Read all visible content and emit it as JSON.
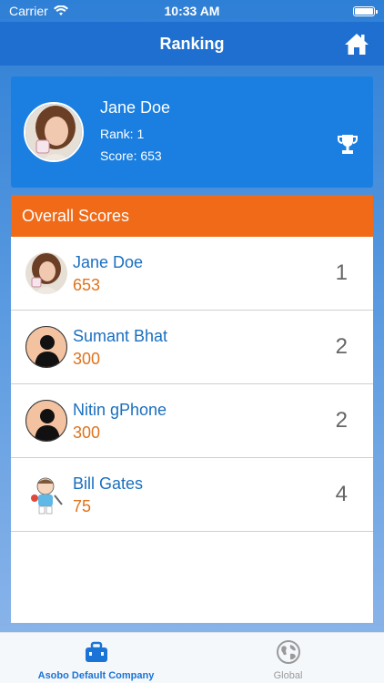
{
  "status_bar": {
    "carrier": "Carrier",
    "time": "10:33 AM"
  },
  "nav": {
    "title": "Ranking",
    "home_icon": "home-icon"
  },
  "profile": {
    "name": "Jane Doe",
    "rank_text": "Rank: 1",
    "score_text": "Score: 653",
    "trophy_icon": "trophy-icon"
  },
  "scores": {
    "header": "Overall Scores",
    "rows": [
      {
        "name": "Jane Doe",
        "score": "653",
        "rank": "1",
        "avatar": "photo"
      },
      {
        "name": "Sumant Bhat",
        "score": "300",
        "rank": "2",
        "avatar": "silhouette"
      },
      {
        "name": "Nitin gPhone",
        "score": "300",
        "rank": "2",
        "avatar": "silhouette"
      },
      {
        "name": "Bill Gates",
        "score": "75",
        "rank": "4",
        "avatar": "cartoon"
      }
    ]
  },
  "tabs": [
    {
      "label": "Asobo Default Company",
      "icon": "briefcase-icon",
      "active": true
    },
    {
      "label": "Global",
      "icon": "globe-icon",
      "active": false
    }
  ],
  "colors": {
    "nav_blue": "#1e6fcf",
    "card_blue": "#1a7fe0",
    "header_orange": "#f06a17",
    "name_blue": "#1a6fbf",
    "score_orange": "#e0731c",
    "active_tab": "#1a73d6"
  }
}
